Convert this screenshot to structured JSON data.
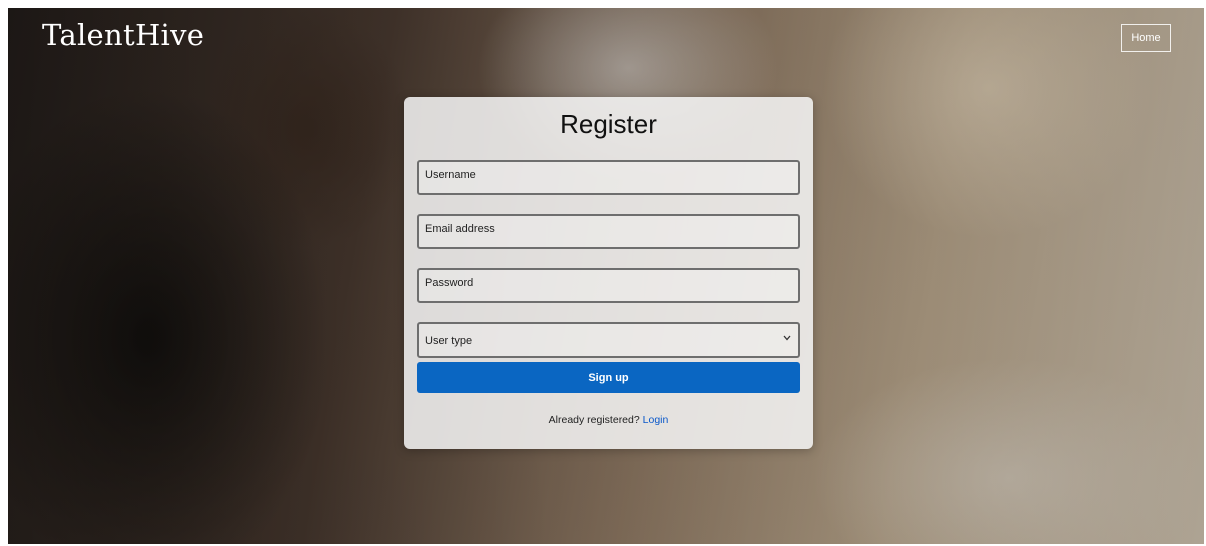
{
  "header": {
    "brand": "TalentHive",
    "home_label": "Home"
  },
  "form": {
    "title": "Register",
    "username_placeholder": "Username",
    "email_placeholder": "Email address",
    "password_placeholder": "Password",
    "user_type_selected": "User type",
    "submit_label": "Sign up",
    "already_registered_text": "Already registered?",
    "login_link": "Login"
  },
  "icons": {
    "select_arrow": "chevron-down-icon"
  },
  "colors": {
    "primary_button": "#0a66c2",
    "link": "#0a58ca"
  }
}
